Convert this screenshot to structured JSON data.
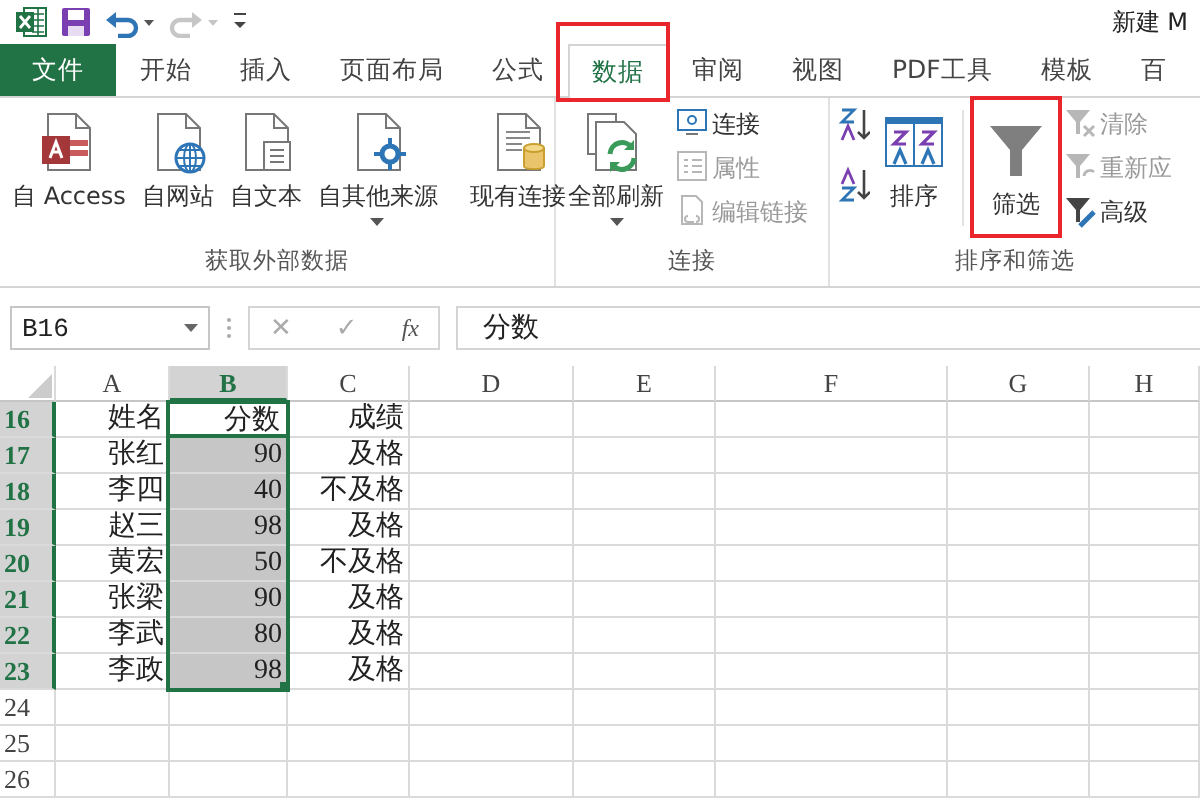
{
  "quick_access": [
    {
      "kind": "logo",
      "disabled": false
    },
    {
      "kind": "save",
      "disabled": false
    },
    {
      "kind": "undo",
      "disabled": false
    },
    {
      "kind": "redo",
      "disabled": true
    },
    {
      "kind": "customize",
      "disabled": false
    }
  ],
  "window": {
    "title": "新建 M"
  },
  "tabs": [
    {
      "label": "文件",
      "kind": "file",
      "selected": false,
      "highlighted": false
    },
    {
      "label": "开始",
      "kind": "tab",
      "selected": false,
      "highlighted": false
    },
    {
      "label": "插入",
      "kind": "tab",
      "selected": false,
      "highlighted": false
    },
    {
      "label": "页面布局",
      "kind": "tab",
      "selected": false,
      "highlighted": false
    },
    {
      "label": "公式",
      "kind": "tab",
      "selected": false,
      "highlighted": false
    },
    {
      "label": "数据",
      "kind": "tab",
      "selected": true,
      "highlighted": true
    },
    {
      "label": "审阅",
      "kind": "tab",
      "selected": false,
      "highlighted": false
    },
    {
      "label": "视图",
      "kind": "tab",
      "selected": false,
      "highlighted": false
    },
    {
      "label": "PDF工具",
      "kind": "tab",
      "selected": false,
      "highlighted": false
    },
    {
      "label": "模板",
      "kind": "tab",
      "selected": false,
      "highlighted": false
    },
    {
      "label": "百",
      "kind": "tab",
      "selected": false,
      "highlighted": false
    }
  ],
  "ribbon": {
    "groups": [
      {
        "label": "获取外部数据",
        "controls": [
          {
            "kind": "access",
            "label": "自 Access",
            "dropdown": false,
            "highlighted": false
          },
          {
            "kind": "web",
            "label": "自网站",
            "dropdown": false,
            "highlighted": false
          },
          {
            "kind": "text",
            "label": "自文本",
            "dropdown": false,
            "highlighted": false
          },
          {
            "kind": "other",
            "label": "自其他来源",
            "dropdown": true,
            "highlighted": false
          },
          {
            "kind": "separator"
          },
          {
            "kind": "existing",
            "label": "现有连接",
            "dropdown": false,
            "highlighted": false
          }
        ]
      },
      {
        "label": "连接",
        "controls": [
          {
            "kind": "refresh",
            "label": "全部刷新",
            "dropdown": true,
            "highlighted": false
          },
          {
            "kind": "stack",
            "items": [
              {
                "kind": "connections",
                "label": "连接",
                "disabled": false
              },
              {
                "kind": "properties",
                "label": "属性",
                "disabled": true
              },
              {
                "kind": "editlinks",
                "label": "编辑链接",
                "disabled": true
              }
            ]
          }
        ]
      },
      {
        "label": "排序和筛选",
        "controls": [
          {
            "kind": "stack",
            "items": [
              {
                "kind": "sortasc",
                "disabled": false
              },
              {
                "kind": "sortdesc",
                "disabled": false
              }
            ]
          },
          {
            "kind": "sort",
            "label": "排序",
            "dropdown": false,
            "highlighted": false
          },
          {
            "kind": "separator"
          },
          {
            "kind": "filter",
            "label": "筛选",
            "dropdown": false,
            "highlighted": true
          },
          {
            "kind": "stack",
            "items": [
              {
                "kind": "clear",
                "label": "清除",
                "disabled": true
              },
              {
                "kind": "reapply",
                "label": "重新应",
                "disabled": true
              },
              {
                "kind": "advanced",
                "label": "高级",
                "disabled": false
              }
            ]
          }
        ]
      }
    ]
  },
  "formula_bar": {
    "name_box": "B16",
    "cancel": "✕",
    "enter": "✓",
    "function": "fx",
    "value": "分数"
  },
  "sheet": {
    "columns": [
      {
        "label": "A",
        "selected": false
      },
      {
        "label": "B",
        "selected": true
      },
      {
        "label": "C",
        "selected": false
      },
      {
        "label": "D",
        "selected": false
      },
      {
        "label": "E",
        "selected": false
      },
      {
        "label": "F",
        "selected": false
      },
      {
        "label": "G",
        "selected": false
      },
      {
        "label": "H",
        "selected": false
      }
    ],
    "rows": [
      {
        "header": "16",
        "selected": true,
        "cells": [
          {
            "text": "姓名",
            "selected": false,
            "active": false
          },
          {
            "text": "分数",
            "selected": false,
            "active": true
          },
          {
            "text": "成绩",
            "selected": false,
            "active": false
          }
        ]
      },
      {
        "header": "17",
        "selected": true,
        "cells": [
          {
            "text": "张红",
            "selected": false,
            "active": false
          },
          {
            "text": "90",
            "selected": true,
            "active": false
          },
          {
            "text": "及格",
            "selected": false,
            "active": false
          }
        ]
      },
      {
        "header": "18",
        "selected": true,
        "cells": [
          {
            "text": "李四",
            "selected": false,
            "active": false
          },
          {
            "text": "40",
            "selected": true,
            "active": false
          },
          {
            "text": "不及格",
            "selected": false,
            "active": false
          }
        ]
      },
      {
        "header": "19",
        "selected": true,
        "cells": [
          {
            "text": "赵三",
            "selected": false,
            "active": false
          },
          {
            "text": "98",
            "selected": true,
            "active": false
          },
          {
            "text": "及格",
            "selected": false,
            "active": false
          }
        ]
      },
      {
        "header": "20",
        "selected": true,
        "cells": [
          {
            "text": "黄宏",
            "selected": false,
            "active": false
          },
          {
            "text": "50",
            "selected": true,
            "active": false
          },
          {
            "text": "不及格",
            "selected": false,
            "active": false
          }
        ]
      },
      {
        "header": "21",
        "selected": true,
        "cells": [
          {
            "text": "张梁",
            "selected": false,
            "active": false
          },
          {
            "text": "90",
            "selected": true,
            "active": false
          },
          {
            "text": "及格",
            "selected": false,
            "active": false
          }
        ]
      },
      {
        "header": "22",
        "selected": true,
        "cells": [
          {
            "text": "李武",
            "selected": false,
            "active": false
          },
          {
            "text": "80",
            "selected": true,
            "active": false
          },
          {
            "text": "及格",
            "selected": false,
            "active": false
          }
        ]
      },
      {
        "header": "23",
        "selected": true,
        "cells": [
          {
            "text": "李政",
            "selected": false,
            "active": false
          },
          {
            "text": "98",
            "selected": true,
            "active": false
          },
          {
            "text": "及格",
            "selected": false,
            "active": false
          }
        ]
      },
      {
        "header": "24",
        "selected": false
      },
      {
        "header": "25",
        "selected": false
      },
      {
        "header": "26",
        "selected": false
      }
    ]
  }
}
